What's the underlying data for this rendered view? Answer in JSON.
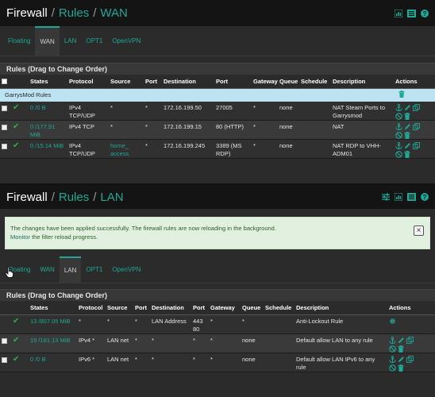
{
  "wan": {
    "breadcrumb": [
      "Firewall",
      "Rules",
      "WAN"
    ],
    "tabs": [
      "Floating",
      "WAN",
      "LAN",
      "OPT1",
      "OpenVPN"
    ],
    "active_tab": "WAN",
    "panel_title": "Rules (Drag to Change Order)",
    "columns": [
      "States",
      "Protocol",
      "Source",
      "Port",
      "Destination",
      "Port",
      "Gateway",
      "Queue",
      "Schedule",
      "Description",
      "Actions"
    ],
    "separator": "GarrysMod Rules",
    "rows": [
      {
        "states": "0 /0 B",
        "protocol": "IPv4 TCP/UDP",
        "source": "*",
        "sport": "*",
        "dest": "172.16.199.50",
        "dport": "27005",
        "gateway": "*",
        "queue": "none",
        "schedule": "",
        "desc": "NAT Steam Ports to Garrysmod"
      },
      {
        "states": "0 /177.91 MiB",
        "protocol": "IPv4 TCP",
        "source": "*",
        "sport": "*",
        "dest": "172.16.199.15",
        "dport": "80 (HTTP)",
        "gateway": "*",
        "queue": "none",
        "schedule": "",
        "desc": "NAT"
      },
      {
        "states": "0 /15.14 MiB",
        "protocol": "IPv4 TCP/UDP",
        "source": "home_ access",
        "sport": "*",
        "dest": "172.16.199.245",
        "dport": "3389 (MS RDP)",
        "gateway": "*",
        "queue": "none",
        "schedule": "",
        "desc": "NAT RDP to VHH-ADM01"
      }
    ]
  },
  "lan": {
    "breadcrumb": [
      "Firewall",
      "Rules",
      "LAN"
    ],
    "alert": {
      "text": "The changes have been applied successfully. The firewall rules are now reloading in the background.",
      "link": "Monitor",
      "text2": " the filter reload progress.",
      "close": "×"
    },
    "tabs": [
      "Floating",
      "WAN",
      "LAN",
      "OPT1",
      "OpenVPN"
    ],
    "active_tab": "LAN",
    "panel_title": "Rules (Drag to Change Order)",
    "columns": [
      "States",
      "Protocol",
      "Source",
      "Port",
      "Destination",
      "Port",
      "Gateway",
      "Queue",
      "Schedule",
      "Description",
      "Actions"
    ],
    "rows": [
      {
        "states": "13 /807.05 MiB",
        "protocol": "*",
        "source": "*",
        "sport": "*",
        "dest": "LAN Address",
        "dport": "443 80",
        "gateway": "*",
        "queue": "*",
        "schedule": "",
        "desc": "Anti-Lockout Rule"
      },
      {
        "states": "19 /181.13 MiB",
        "protocol": "IPv4 *",
        "source": "LAN net",
        "sport": "*",
        "dest": "*",
        "dport": "*",
        "gateway": "*",
        "queue": "none",
        "schedule": "",
        "desc": "Default allow LAN to any rule"
      },
      {
        "states": "0 /0 B",
        "protocol": "IPv6 *",
        "source": "LAN net",
        "sport": "*",
        "dest": "*",
        "dport": "*",
        "gateway": "*",
        "queue": "none",
        "schedule": "",
        "desc": "Default allow LAN IPv6 to any rule"
      }
    ]
  },
  "colors": {
    "accent": "#1ea896",
    "pass": "#26b543",
    "separator": "#bde2f2"
  },
  "icons": [
    "bar-chart-icon",
    "list-icon",
    "help-icon",
    "sliders-icon",
    "anchor-icon",
    "pencil-icon",
    "copy-icon",
    "ban-icon",
    "trash-icon",
    "gear-icon",
    "check-icon"
  ]
}
